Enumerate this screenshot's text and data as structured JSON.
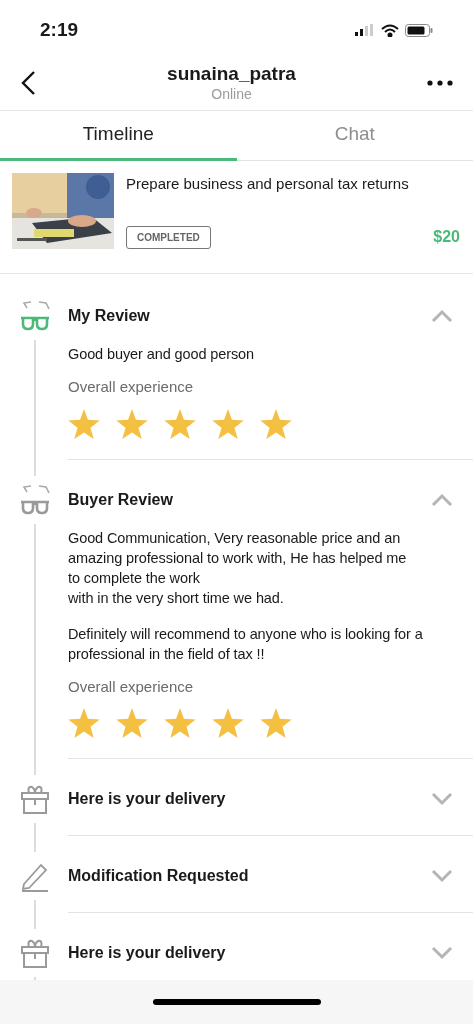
{
  "status_bar": {
    "time": "2:19"
  },
  "header": {
    "title": "sunaina_patra",
    "subtitle": "Online"
  },
  "tabs": [
    {
      "label": "Timeline",
      "selected": true
    },
    {
      "label": "Chat",
      "selected": false
    }
  ],
  "order": {
    "title": "Prepare business and personal tax returns",
    "status": "COMPLETED",
    "price": "$20"
  },
  "timeline": [
    {
      "kind": "review",
      "title": "My Review",
      "active": true,
      "expanded": true,
      "body": [
        "Good buyer and good person"
      ],
      "rating_label": "Overall experience",
      "stars": 5
    },
    {
      "kind": "review",
      "title": "Buyer Review",
      "active": false,
      "expanded": true,
      "body": [
        "Good Communication, Very reasonable price and an amazing professional to work with, He has helped me\nto complete the work\nwith in the very short time we had.",
        "Definitely will recommend to anyone who is looking for a professional in the field of tax !!"
      ],
      "rating_label": "Overall experience",
      "stars": 5
    },
    {
      "kind": "delivery",
      "title": "Here is your delivery",
      "active": false,
      "expanded": false
    },
    {
      "kind": "modification",
      "title": "Modification Requested",
      "active": false,
      "expanded": false
    },
    {
      "kind": "delivery",
      "title": "Here is your delivery",
      "active": false,
      "expanded": false
    }
  ]
}
